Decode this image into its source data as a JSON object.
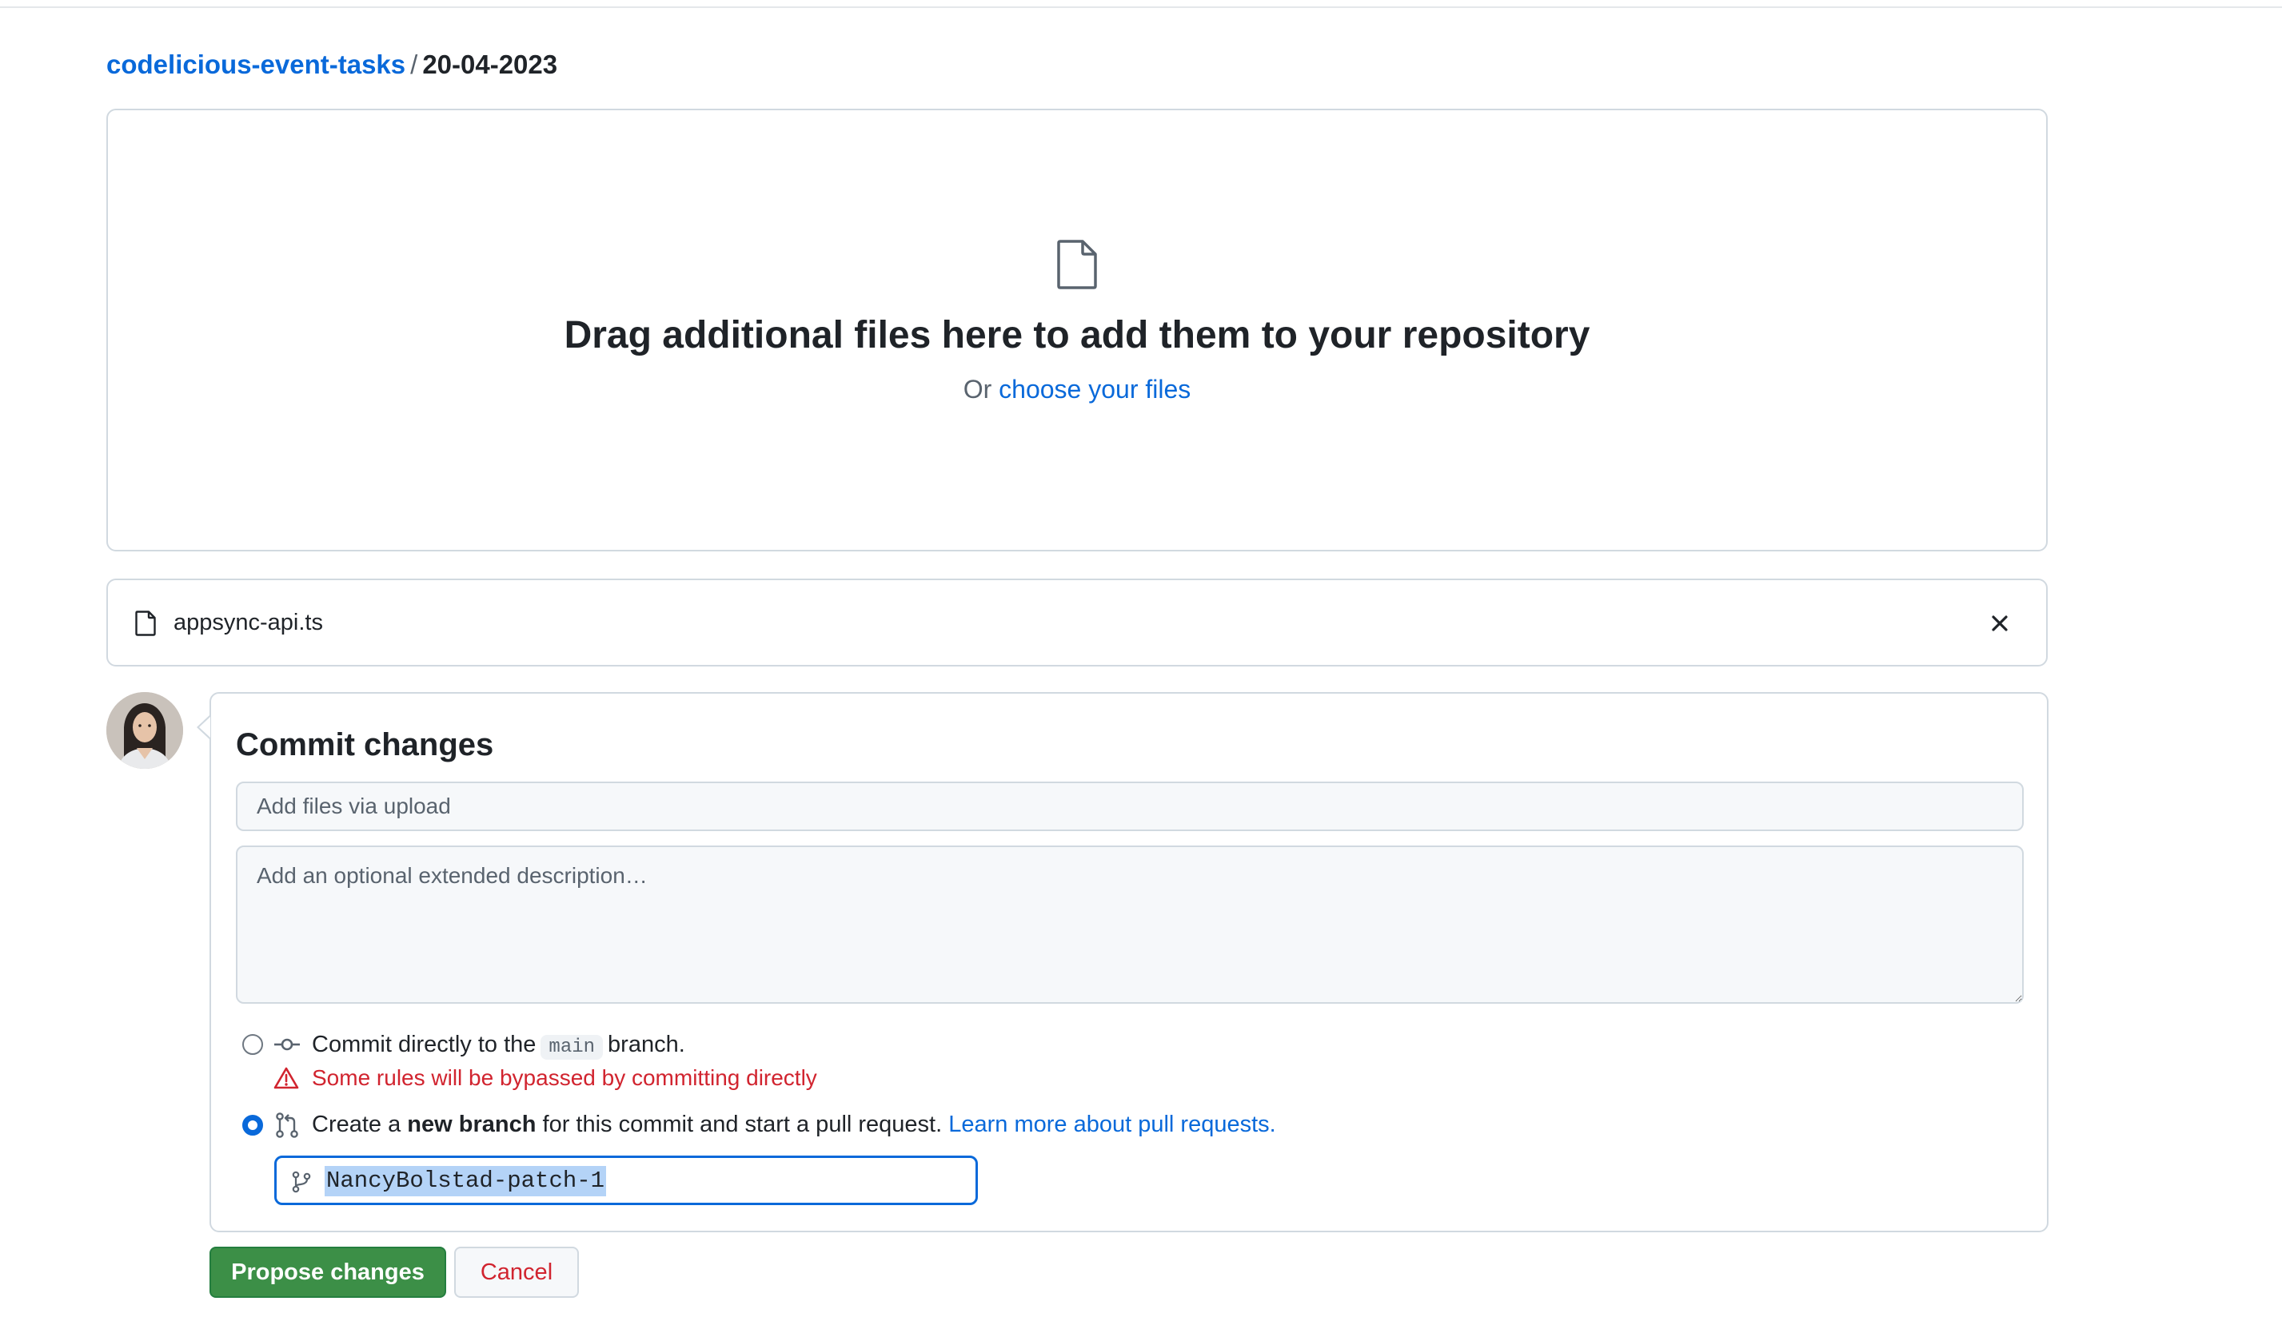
{
  "breadcrumb": {
    "repo": "codelicious-event-tasks",
    "separator": "/",
    "directory": "20-04-2023"
  },
  "dropzone": {
    "icon": "file-icon",
    "title": "Drag additional files here to add them to your repository",
    "or_text": "Or",
    "choose_link": "choose your files"
  },
  "uploaded_file": {
    "icon": "file-icon",
    "name": "appsync-api.ts",
    "remove_icon": "close-icon"
  },
  "commit": {
    "title": "Commit changes",
    "summary_placeholder": "Add files via upload",
    "description_placeholder": "Add an optional extended description…",
    "option_direct": {
      "selected": false,
      "text_before": "Commit directly to the",
      "branch": "main",
      "text_after": "branch.",
      "warning": "Some rules will be bypassed by committing directly"
    },
    "option_new_branch": {
      "selected": true,
      "text_before": "Create a",
      "bold": "new branch",
      "text_after": "for this commit and start a pull request.",
      "link": "Learn more about pull requests."
    },
    "branch_name": "NancyBolstad-patch-1"
  },
  "buttons": {
    "propose": "Propose changes",
    "cancel": "Cancel"
  },
  "colors": {
    "link": "#0969da",
    "danger": "#d1242f",
    "primary_button": "#3c8f47",
    "border": "#d1d9e0"
  }
}
